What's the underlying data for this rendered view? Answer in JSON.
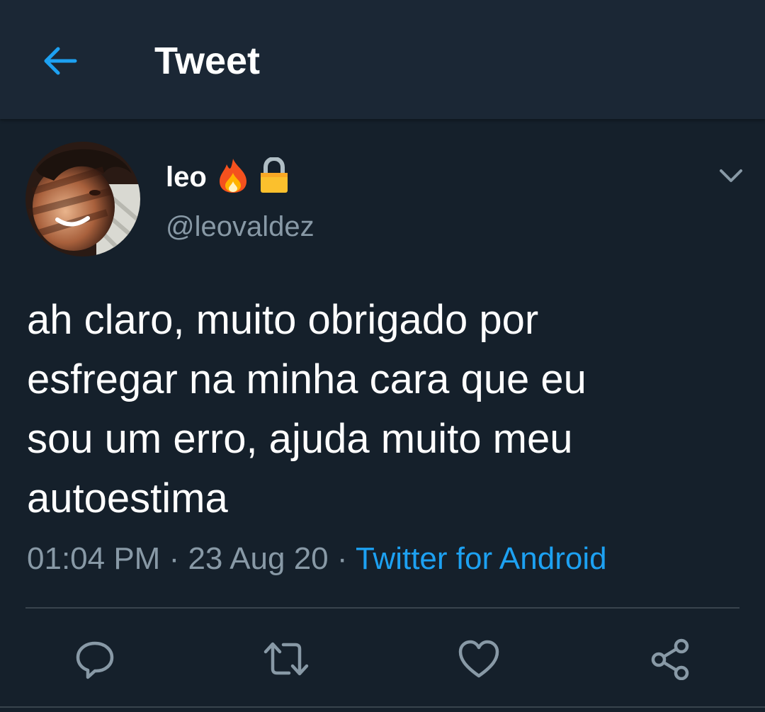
{
  "header": {
    "title": "Tweet",
    "back_icon": "arrow-left-icon",
    "accent": "#1da1f2",
    "background": "#1b2735"
  },
  "author": {
    "display_name": "leo",
    "badges": [
      "fire-emoji-icon",
      "lock-icon"
    ],
    "handle": "@leovaldez"
  },
  "tweet": {
    "text": "ah claro, muito obrigado por\nesfregar na minha cara que eu\nsou um erro, ajuda muito meu\nautoestima",
    "time": "01:04 PM",
    "separator": " · ",
    "date": "23 Aug 20",
    "source": "Twitter for Android"
  },
  "actions": {
    "icons": [
      "reply-icon",
      "retweet-icon",
      "like-icon",
      "share-icon"
    ]
  },
  "colors": {
    "page_background": "#15202b",
    "secondary_text": "#8899a6",
    "link": "#1da1f2",
    "divider": "#38444d"
  }
}
